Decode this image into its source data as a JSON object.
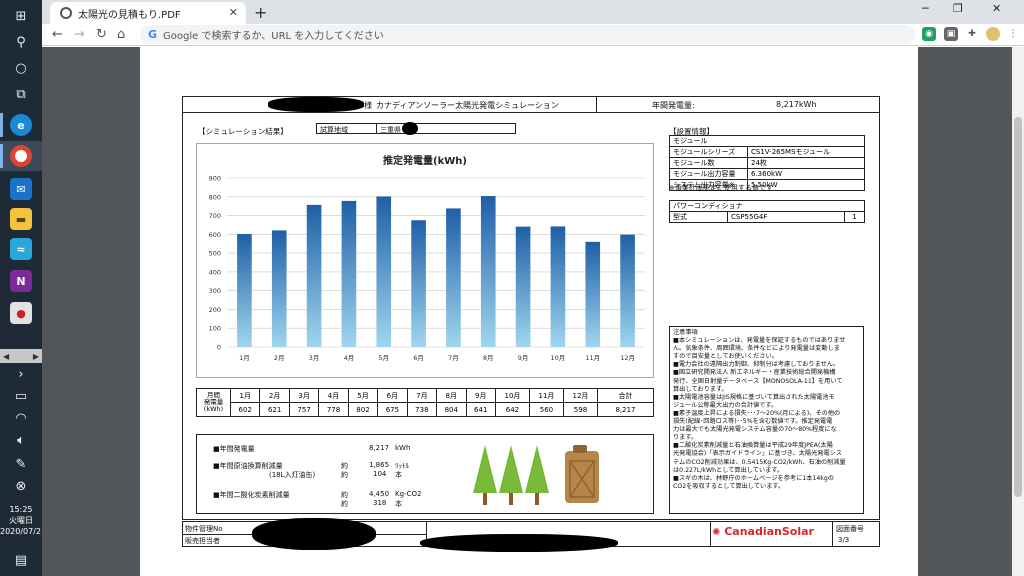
{
  "taskbar": {
    "clock_time": "15:25",
    "clock_day": "火曜日",
    "clock_date": "2020/07/21"
  },
  "browser": {
    "tab_title": "太陽光の見積もり.PDF",
    "omnibox_placeholder": "Google で検索するか、URL を入力してください",
    "omnibox_brand": "G"
  },
  "doc": {
    "header_suffix": "様",
    "header_title": "カナディアンソーラー太陽光発電シミュレーション",
    "annual_label": "年間発電量:",
    "annual_value": "8,217kWh",
    "sim_result_label": "【シミュレーション結果】",
    "area_label": "試算地域",
    "area_value": "三重県",
    "setup": {
      "heading": "【設置情報】",
      "module_heading": "モジュール",
      "rows": [
        {
          "label": "モジュールシリーズ",
          "value": "CS1V-265MSモジュール"
        },
        {
          "label": "モジュール数",
          "value": "24枚"
        },
        {
          "label": "モジュール出力容量",
          "value": "6.360kW"
        },
        {
          "label": "システム出力容量※",
          "value": "5.50kW"
        }
      ],
      "note": "※事業計画認定に使用する値です",
      "pcs_heading": "パワーコンディショナ",
      "pcs_type_label": "型式",
      "pcs_type_value": "CSP55G4F",
      "pcs_qty": "1"
    },
    "notes_heading": "注意事項",
    "notes": [
      "■本シミュレーションは、発電量を保証するものではありませ",
      "ん。気象条件、周囲環境、条件などにより発電量は変動しま",
      "すので目安量としてお使いください。",
      "■電力会社の遠隔出力制御、抑制分は考慮しておりません。",
      "■国立研究開発法人 新エネルギー・産業技術総合開発機構",
      "発行、全国日射量データベース【MONOSOLA-11】を用いて",
      "算出しております。",
      "■太陽電池容量はJIS規格に基づいて算出された太陽電池モ",
      "ジュール公称最大出力の合計値です。",
      "■素子温度上昇による損失･･･7～20%(月による)、その他の",
      "損失(配線･回路ロス等)･･5%を含む数値です。推定発電電",
      "力は最大でも太陽光発電システム容量の70～80%程度にな",
      "ります。",
      "■二酸化炭素削減量と石油換算量は平成29年度JPEA(太陽",
      "光発電協会)「表示ガイドライン」に基づき、太陽光発電シス",
      "テムのCO2削減効果は、0.5415Kg-CO2/kWh、石油の削減量",
      "は0.227L/kWhとして算出しています。",
      "■スギの木は、林野庁のホームページを参考に1本14kgの",
      "CO2を吸収するとして算出しています。"
    ],
    "monthly": {
      "row_label_1": "月間",
      "row_label_2": "発電量",
      "row_label_3": "(kWh)",
      "total_label": "合計",
      "total_value": "8,217",
      "months": [
        "1月",
        "2月",
        "3月",
        "4月",
        "5月",
        "6月",
        "7月",
        "8月",
        "9月",
        "10月",
        "11月",
        "12月"
      ],
      "values": [
        "602",
        "621",
        "757",
        "778",
        "802",
        "675",
        "738",
        "804",
        "641",
        "642",
        "560",
        "598"
      ]
    },
    "eco": {
      "annual_label": "■年間発電量",
      "annual_value": "8,217",
      "annual_unit": "kWh",
      "oil_label": "■年間原油換算削減量",
      "oil_sub": "(18L入灯油缶)",
      "approx": "約",
      "oil_value": "1,865",
      "oil_unit": "ﾘｯﾄﾙ",
      "can_value": "104",
      "can_unit": "本",
      "co2_label": "■年間二酸化炭素削減量",
      "co2_value": "4,450",
      "co2_unit": "Kg-CO2",
      "tree_value": "318",
      "tree_unit": "本"
    },
    "footer": {
      "property_label": "物件管理No",
      "sales_label": "販売担当者",
      "brand": "CanadianSolar",
      "drawing_label": "図面番号",
      "page": "3/3"
    }
  },
  "chart_data": {
    "type": "bar",
    "title": "推定発電量(kWh)",
    "categories": [
      "1月",
      "2月",
      "3月",
      "4月",
      "5月",
      "6月",
      "7月",
      "8月",
      "9月",
      "10月",
      "11月",
      "12月"
    ],
    "values": [
      602,
      621,
      757,
      778,
      802,
      675,
      738,
      804,
      641,
      642,
      560,
      598
    ],
    "ylim": [
      0,
      900
    ],
    "yticks": [
      "0",
      "100",
      "200",
      "300",
      "400",
      "500",
      "600",
      "700",
      "800",
      "900"
    ],
    "grid": true,
    "bar_color_top": "#1f5fa6",
    "bar_color_bottom": "#9fd6ef"
  },
  "colors": {
    "taskbar": "#1e2b36",
    "viewer_bg": "#525659",
    "accent_red": "#d7272a",
    "tree_green": "#79b93a",
    "can_brown": "#b5854a"
  }
}
